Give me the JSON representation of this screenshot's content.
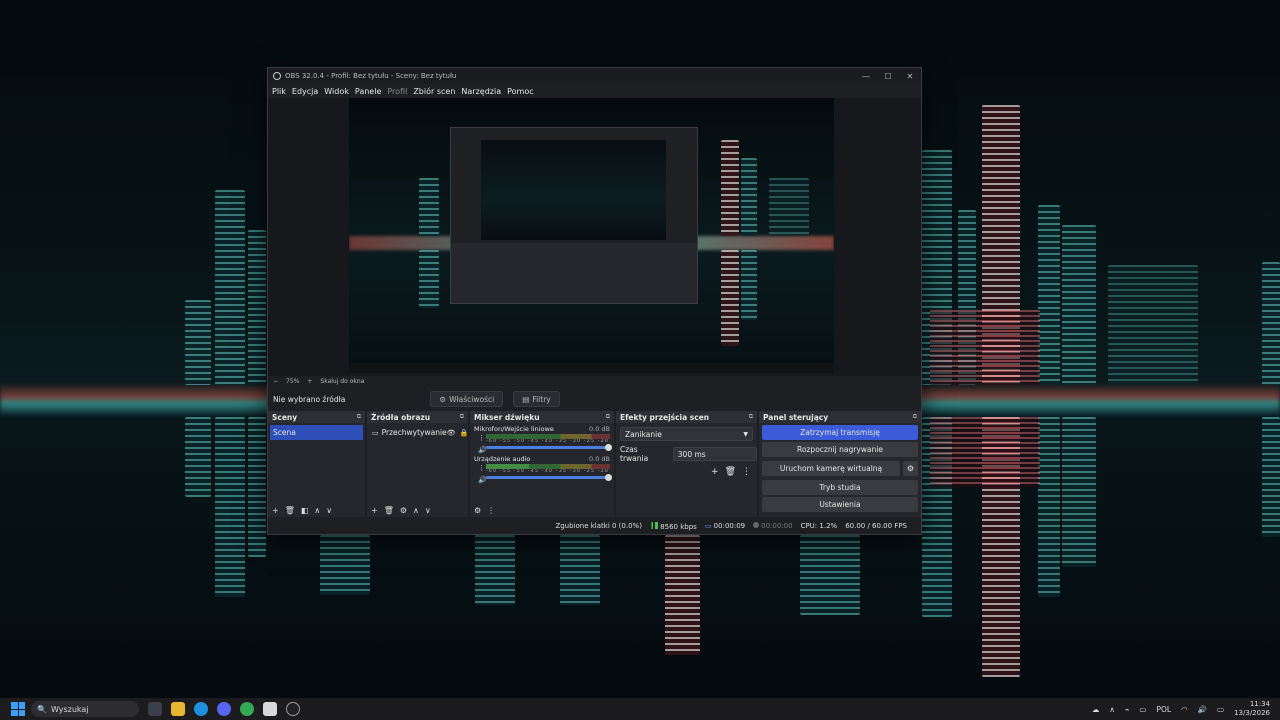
{
  "window": {
    "title": "OBS 32.0.4 - Profil: Bez tytułu - Sceny: Bez tytułu",
    "controls": [
      "—",
      "☐",
      "✕"
    ]
  },
  "menu": [
    "Plik",
    "Edycja",
    "Widok",
    "Panele",
    "Profil",
    "Zbiór scen",
    "Narzędzia",
    "Pomoc"
  ],
  "zoom": {
    "value": "75%",
    "mode": "Skaluj do okna"
  },
  "source_toolbar": {
    "status": "Nie wybrano źródła",
    "properties": "Właściwości",
    "filters": "Filtry"
  },
  "scenes": {
    "title": "Sceny",
    "items": [
      "Scena"
    ]
  },
  "sources": {
    "title": "Źródła obrazu",
    "items": [
      {
        "label": "Przechwytywanie"
      }
    ]
  },
  "mixer": {
    "title": "Mikser dźwięku",
    "channels": [
      {
        "name": "Mikrofon/Wejście liniowe",
        "level": "0.0 dB",
        "fill": 0.0
      },
      {
        "name": "Urządzenie audio",
        "level": "0.0 dB",
        "fill": 0.35
      }
    ],
    "scale": "-60 -55 -50 -45 -40 -35 -30 -25 -20 -15 -10 -5 0"
  },
  "transitions": {
    "title": "Efekty przejścia scen",
    "selected": "Zanikanie",
    "duration_label": "Czas trwania",
    "duration_value": "300 ms"
  },
  "controls": {
    "title": "Panel sterujący",
    "stop_stream": "Zatrzymaj transmisję",
    "start_record": "Rozpocznij nagrywanie",
    "virtual_cam": "Uruchom kamerę wirtualną",
    "studio_mode": "Tryb studia",
    "settings": "Ustawienia"
  },
  "status": {
    "dropped": "Zgubione klatki 0 (0.0%)",
    "bitrate": "8560 kbps",
    "stream_time": "00:00:09",
    "rec_time": "00:00:00",
    "cpu": "CPU: 1.2%",
    "fps": "60.00 / 60.00 FPS"
  },
  "taskbar": {
    "search_placeholder": "Wyszukaj",
    "language": "POL",
    "time": "11:34",
    "date": "13/3/2026"
  },
  "colors": {
    "accent": "#3b5bd8",
    "scene_selected": "#2f4fb8"
  }
}
